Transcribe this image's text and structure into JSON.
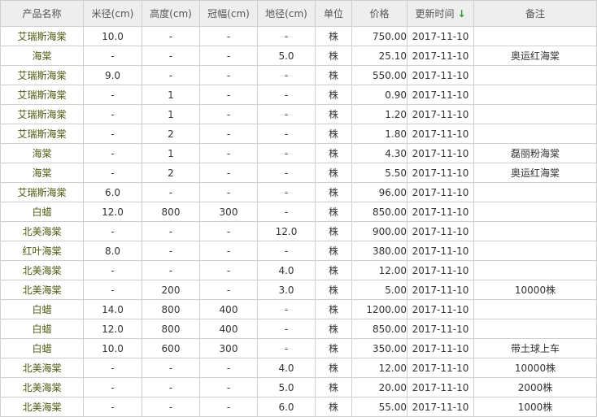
{
  "header": {
    "name": "产品名称",
    "diameter": "米径(cm)",
    "height": "高度(cm)",
    "crown": "冠幅(cm)",
    "ground": "地径(cm)",
    "unit": "单位",
    "price": "价格",
    "updated": "更新时间",
    "note": "备注",
    "sort_icon": "arrow-down-icon"
  },
  "rows": [
    {
      "name": "艾瑞斯海棠",
      "diameter": "10.0",
      "height": "-",
      "crown": "-",
      "ground": "-",
      "unit": "株",
      "price": "750.00",
      "updated": "2017-11-10",
      "note": ""
    },
    {
      "name": "海棠",
      "diameter": "-",
      "height": "-",
      "crown": "-",
      "ground": "5.0",
      "unit": "株",
      "price": "25.10",
      "updated": "2017-11-10",
      "note": "奥运红海棠"
    },
    {
      "name": "艾瑞斯海棠",
      "diameter": "9.0",
      "height": "-",
      "crown": "-",
      "ground": "-",
      "unit": "株",
      "price": "550.00",
      "updated": "2017-11-10",
      "note": ""
    },
    {
      "name": "艾瑞斯海棠",
      "diameter": "-",
      "height": "1",
      "crown": "-",
      "ground": "-",
      "unit": "株",
      "price": "0.90",
      "updated": "2017-11-10",
      "note": ""
    },
    {
      "name": "艾瑞斯海棠",
      "diameter": "-",
      "height": "1",
      "crown": "-",
      "ground": "-",
      "unit": "株",
      "price": "1.20",
      "updated": "2017-11-10",
      "note": ""
    },
    {
      "name": "艾瑞斯海棠",
      "diameter": "-",
      "height": "2",
      "crown": "-",
      "ground": "-",
      "unit": "株",
      "price": "1.80",
      "updated": "2017-11-10",
      "note": ""
    },
    {
      "name": "海棠",
      "diameter": "-",
      "height": "1",
      "crown": "-",
      "ground": "-",
      "unit": "株",
      "price": "4.30",
      "updated": "2017-11-10",
      "note": "磊丽粉海棠"
    },
    {
      "name": "海棠",
      "diameter": "-",
      "height": "2",
      "crown": "-",
      "ground": "-",
      "unit": "株",
      "price": "5.50",
      "updated": "2017-11-10",
      "note": "奥运红海棠"
    },
    {
      "name": "艾瑞斯海棠",
      "diameter": "6.0",
      "height": "-",
      "crown": "-",
      "ground": "-",
      "unit": "株",
      "price": "96.00",
      "updated": "2017-11-10",
      "note": ""
    },
    {
      "name": "白蜡",
      "diameter": "12.0",
      "height": "800",
      "crown": "300",
      "ground": "-",
      "unit": "株",
      "price": "850.00",
      "updated": "2017-11-10",
      "note": ""
    },
    {
      "name": "北美海棠",
      "diameter": "-",
      "height": "-",
      "crown": "-",
      "ground": "12.0",
      "unit": "株",
      "price": "900.00",
      "updated": "2017-11-10",
      "note": ""
    },
    {
      "name": "红叶海棠",
      "diameter": "8.0",
      "height": "-",
      "crown": "-",
      "ground": "-",
      "unit": "株",
      "price": "380.00",
      "updated": "2017-11-10",
      "note": ""
    },
    {
      "name": "北美海棠",
      "diameter": "-",
      "height": "-",
      "crown": "-",
      "ground": "4.0",
      "unit": "株",
      "price": "12.00",
      "updated": "2017-11-10",
      "note": ""
    },
    {
      "name": "北美海棠",
      "diameter": "-",
      "height": "200",
      "crown": "-",
      "ground": "3.0",
      "unit": "株",
      "price": "5.00",
      "updated": "2017-11-10",
      "note": "10000株"
    },
    {
      "name": "白蜡",
      "diameter": "14.0",
      "height": "800",
      "crown": "400",
      "ground": "-",
      "unit": "株",
      "price": "1200.00",
      "updated": "2017-11-10",
      "note": ""
    },
    {
      "name": "白蜡",
      "diameter": "12.0",
      "height": "800",
      "crown": "400",
      "ground": "-",
      "unit": "株",
      "price": "850.00",
      "updated": "2017-11-10",
      "note": ""
    },
    {
      "name": "白蜡",
      "diameter": "10.0",
      "height": "600",
      "crown": "300",
      "ground": "-",
      "unit": "株",
      "price": "350.00",
      "updated": "2017-11-10",
      "note": "带土球上车"
    },
    {
      "name": "北美海棠",
      "diameter": "-",
      "height": "-",
      "crown": "-",
      "ground": "4.0",
      "unit": "株",
      "price": "12.00",
      "updated": "2017-11-10",
      "note": "10000株"
    },
    {
      "name": "北美海棠",
      "diameter": "-",
      "height": "-",
      "crown": "-",
      "ground": "5.0",
      "unit": "株",
      "price": "20.00",
      "updated": "2017-11-10",
      "note": "2000株"
    },
    {
      "name": "北美海棠",
      "diameter": "-",
      "height": "-",
      "crown": "-",
      "ground": "6.0",
      "unit": "株",
      "price": "55.00",
      "updated": "2017-11-10",
      "note": "1000株"
    }
  ]
}
